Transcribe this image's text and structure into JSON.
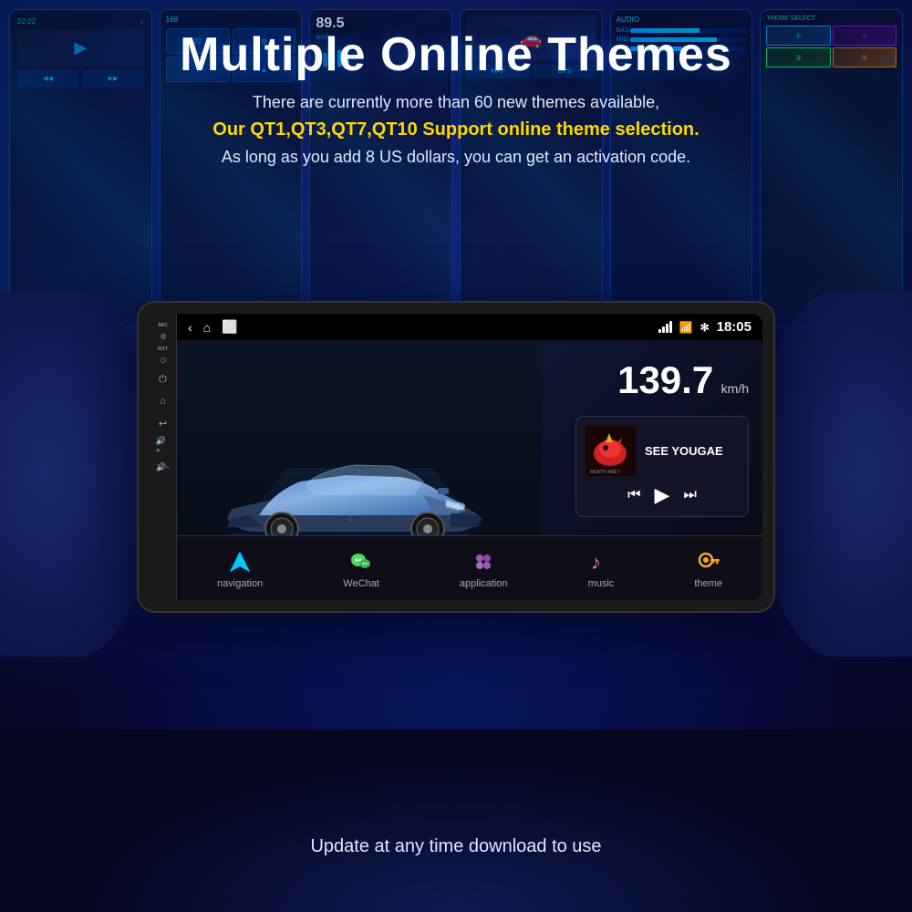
{
  "page": {
    "title": "Multiple Online Themes",
    "subtitle1": "There are currently more than 60 new themes available,",
    "subtitle2": "Our QT1,QT3,QT7,QT10 Support online theme selection.",
    "subtitle3": "As long as you add 8 US dollars, you can get an activation code.",
    "footer": "Update at any time download to use"
  },
  "screen": {
    "status": {
      "time": "18:05",
      "wifi_icon": "📶",
      "bt_icon": "✻"
    },
    "speed": {
      "value": "139.7",
      "unit": "km/h"
    },
    "music": {
      "title": "SEE YOUGAE",
      "album_note": "🎵"
    },
    "nav_items": [
      {
        "id": "navigation",
        "label": "navigation",
        "icon": "▲",
        "color": "#00c8ff"
      },
      {
        "id": "wechat",
        "label": "WeChat",
        "icon": "💬",
        "color": "#4cd964"
      },
      {
        "id": "application",
        "label": "application",
        "icon": "⊞",
        "color": "#9b59b6"
      },
      {
        "id": "music",
        "label": "music",
        "icon": "♪",
        "color": "#ff6eb4"
      },
      {
        "id": "theme",
        "label": "theme",
        "icon": "🔑",
        "color": "#f5a623"
      }
    ],
    "side_buttons": [
      {
        "label": "MIC",
        "type": "text"
      },
      {
        "label": "RST",
        "type": "text"
      },
      {
        "icon": "⏻",
        "type": "power"
      },
      {
        "icon": "⌂",
        "type": "home"
      },
      {
        "icon": "↩",
        "type": "back"
      },
      {
        "icon": "🔊+",
        "type": "vol-up"
      },
      {
        "icon": "🔊-",
        "type": "vol-down"
      }
    ]
  },
  "colors": {
    "background": "#0a0a2e",
    "title_color": "#ffffff",
    "subtitle_yellow": "#ffd700",
    "subtitle_white": "#e0e8ff",
    "accent_blue": "#0055ff"
  }
}
